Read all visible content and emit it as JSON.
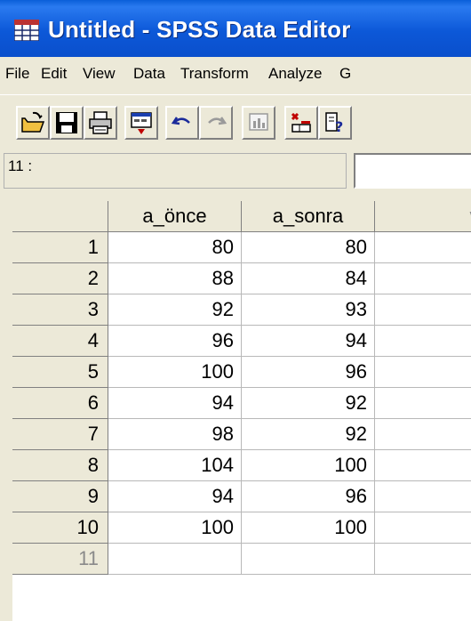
{
  "window": {
    "title": "Untitled - SPSS Data Editor",
    "icon": "spss-grid-icon"
  },
  "menu": [
    "File",
    "Edit",
    "View",
    "Data",
    "Transform",
    "Analyze",
    "G"
  ],
  "toolbar": {
    "buttons": [
      "open-folder-icon",
      "save-disk-icon",
      "print-icon",
      "dialog-recall-icon",
      "undo-icon",
      "redo-icon",
      "goto-chart-icon",
      "insert-cases-icon",
      "variables-help-icon"
    ]
  },
  "cell_editor": {
    "reference": "11 :",
    "value": ""
  },
  "grid": {
    "columns": [
      "a_önce",
      "a_sonra",
      "var"
    ],
    "rows": [
      {
        "n": "1",
        "a_once": "80",
        "a_sonra": "80"
      },
      {
        "n": "2",
        "a_once": "88",
        "a_sonra": "84"
      },
      {
        "n": "3",
        "a_once": "92",
        "a_sonra": "93"
      },
      {
        "n": "4",
        "a_once": "96",
        "a_sonra": "94"
      },
      {
        "n": "5",
        "a_once": "100",
        "a_sonra": "96"
      },
      {
        "n": "6",
        "a_once": "94",
        "a_sonra": "92"
      },
      {
        "n": "7",
        "a_once": "98",
        "a_sonra": "92"
      },
      {
        "n": "8",
        "a_once": "104",
        "a_sonra": "100"
      },
      {
        "n": "9",
        "a_once": "94",
        "a_sonra": "96"
      },
      {
        "n": "10",
        "a_once": "100",
        "a_sonra": "100"
      },
      {
        "n": "11",
        "a_once": "",
        "a_sonra": ""
      }
    ]
  },
  "colors": {
    "titlebar": "#0a5fd9",
    "chrome": "#ece9d8",
    "dim_text": "#8a8a8a"
  }
}
